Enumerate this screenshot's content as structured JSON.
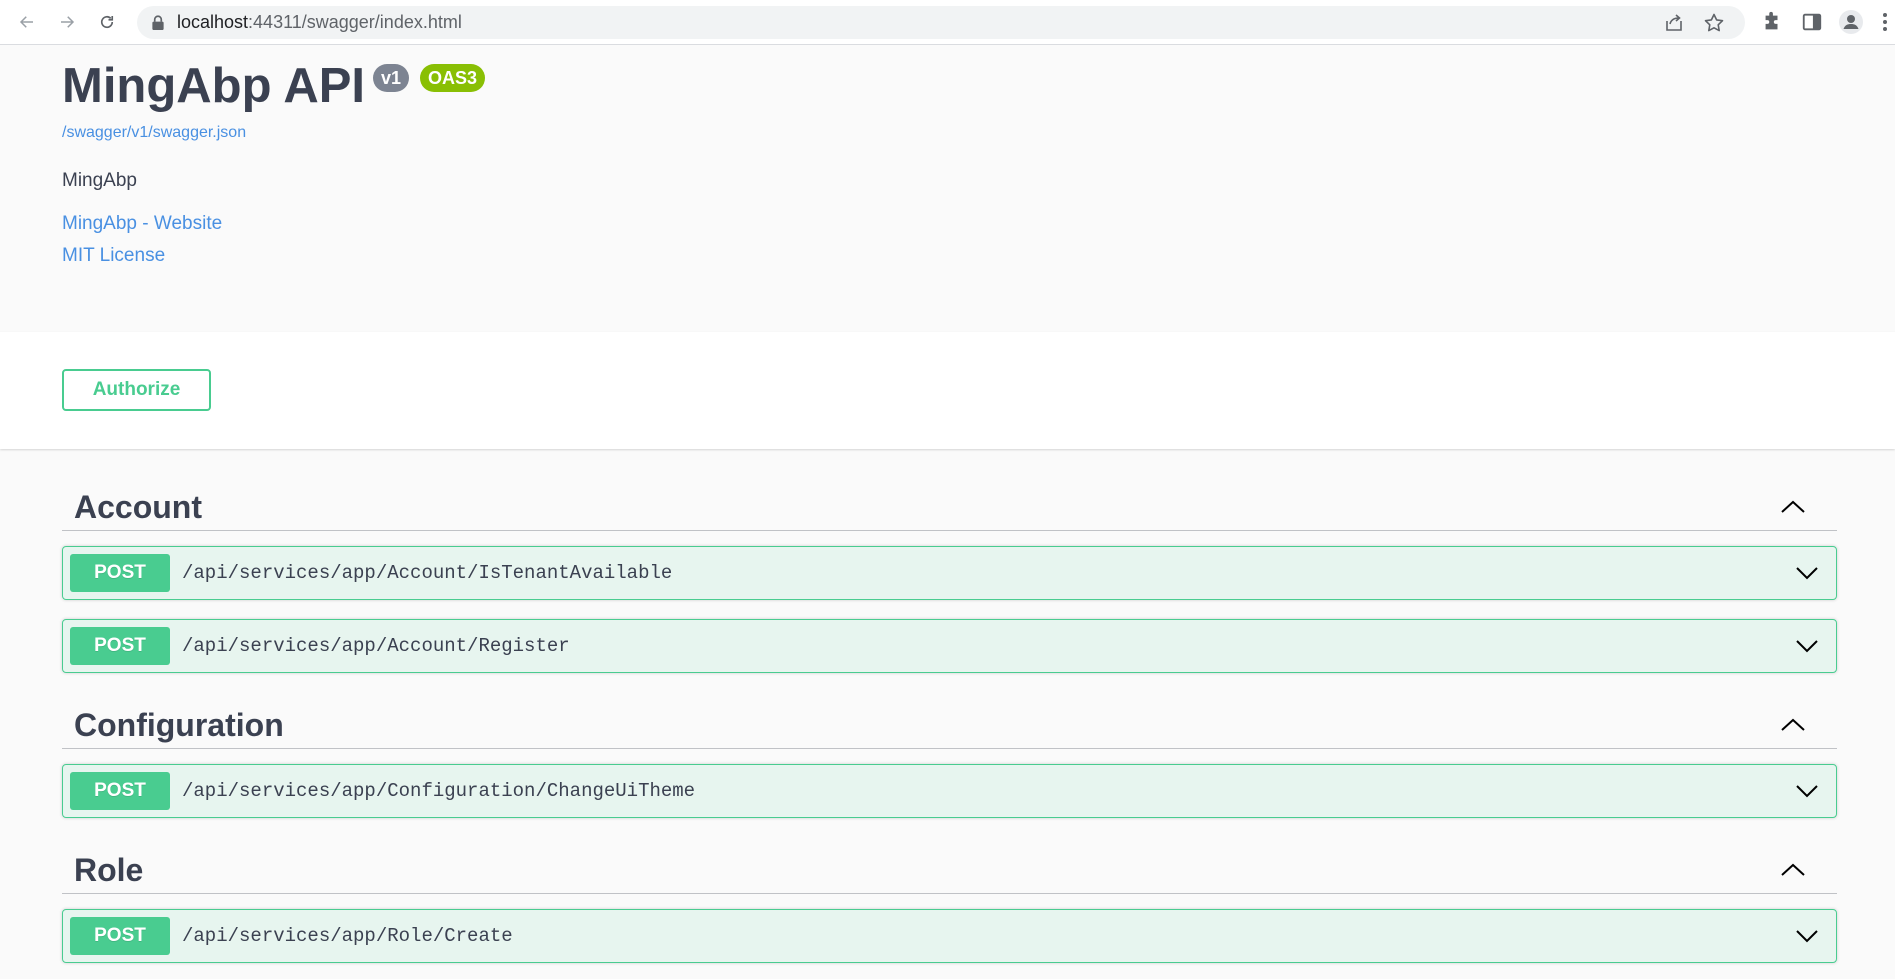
{
  "browser": {
    "url_host": "localhost",
    "url_rest": ":44311/swagger/index.html"
  },
  "info": {
    "title": "MingAbp API",
    "version_badge": "v1",
    "oas_badge": "OAS3",
    "spec_url": "/swagger/v1/swagger.json",
    "description": "MingAbp",
    "website_link": "MingAbp - Website",
    "license_link": "MIT License"
  },
  "scheme": {
    "authorize_label": "Authorize"
  },
  "tags": [
    {
      "name": "Account",
      "operations": [
        {
          "method": "POST",
          "path": "/api/services/app/Account/IsTenantAvailable"
        },
        {
          "method": "POST",
          "path": "/api/services/app/Account/Register"
        }
      ]
    },
    {
      "name": "Configuration",
      "operations": [
        {
          "method": "POST",
          "path": "/api/services/app/Configuration/ChangeUiTheme"
        }
      ]
    },
    {
      "name": "Role",
      "operations": [
        {
          "method": "POST",
          "path": "/api/services/app/Role/Create"
        }
      ]
    }
  ],
  "colors": {
    "post": "#49cc90",
    "link": "#4990e2",
    "version_badge": "#7d8492",
    "oas_badge": "#89bf04"
  }
}
